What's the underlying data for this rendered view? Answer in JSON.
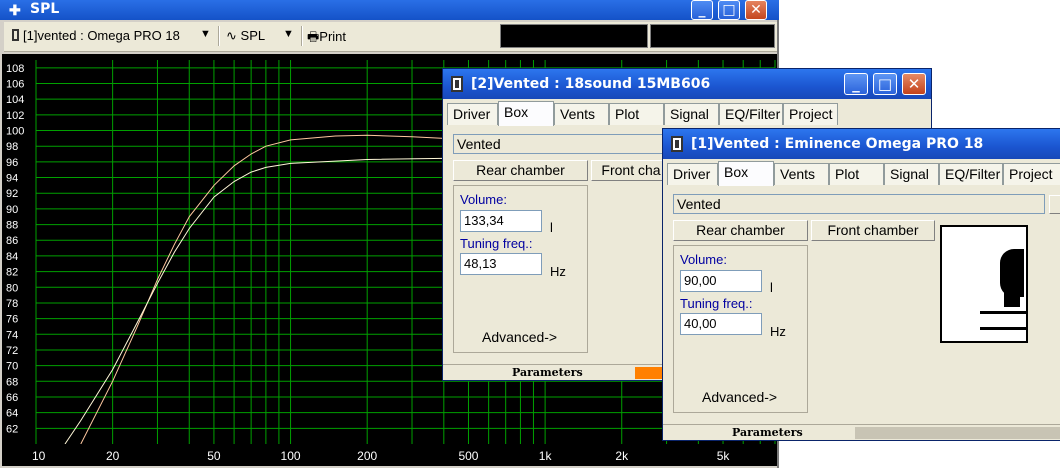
{
  "spl_window": {
    "title": "SPL",
    "toolbar": {
      "project_select": "[1]vented : Omega PRO 18",
      "view_select": "SPL",
      "print_label": "Print"
    }
  },
  "chart_data": {
    "type": "line",
    "xscale": "log",
    "xlim": [
      10,
      8000
    ],
    "ylim": [
      60,
      109
    ],
    "x_ticks": [
      10,
      20,
      50,
      100,
      200,
      500,
      1000,
      2000,
      5000
    ],
    "x_tick_labels": [
      "10",
      "20",
      "50",
      "100",
      "200",
      "500",
      "1k",
      "2k",
      "5k"
    ],
    "y_ticks": [
      62,
      64,
      66,
      68,
      70,
      72,
      74,
      76,
      78,
      80,
      82,
      84,
      86,
      88,
      90,
      92,
      94,
      96,
      98,
      100,
      102,
      104,
      106,
      108
    ],
    "grid": true,
    "colors": {
      "background": "#000000",
      "grid": "#00a000",
      "axis_text": "#ffffff"
    },
    "series": [
      {
        "color": "#ffc8a0",
        "points": [
          [
            15,
            60
          ],
          [
            20,
            68
          ],
          [
            25,
            75
          ],
          [
            30,
            81
          ],
          [
            35,
            85.5
          ],
          [
            40,
            89
          ],
          [
            50,
            93
          ],
          [
            60,
            95.5
          ],
          [
            70,
            97
          ],
          [
            80,
            98
          ],
          [
            100,
            98.8
          ],
          [
            150,
            99.3
          ],
          [
            200,
            99.4
          ],
          [
            300,
            99.2
          ],
          [
            400,
            99
          ],
          [
            500,
            98.8
          ],
          [
            800,
            98.6
          ],
          [
            8000,
            98.6
          ]
        ]
      },
      {
        "color": "#fff8d8",
        "points": [
          [
            13,
            60
          ],
          [
            15,
            63
          ],
          [
            20,
            69.5
          ],
          [
            25,
            75.5
          ],
          [
            30,
            80.5
          ],
          [
            35,
            84.5
          ],
          [
            40,
            87.5
          ],
          [
            50,
            91.5
          ],
          [
            60,
            93.5
          ],
          [
            70,
            94.7
          ],
          [
            80,
            95.3
          ],
          [
            100,
            95.8
          ],
          [
            150,
            96.1
          ],
          [
            200,
            96.3
          ],
          [
            500,
            96.5
          ],
          [
            8000,
            96.6
          ]
        ]
      }
    ]
  },
  "dialog2": {
    "title": "[2]Vented : 18sound 15MB606",
    "tabs": [
      "Driver",
      "Box",
      "Vents",
      "Plot",
      "Signal",
      "EQ/Filter",
      "Project"
    ],
    "box_type": "Vented",
    "rear_chamber_label": "Rear chamber",
    "front_chamber_label": "Front cha",
    "volume_label": "Volume:",
    "volume_value": "133,34",
    "volume_unit": "l",
    "tuning_label": "Tuning freq.:",
    "tuning_value": "48,13",
    "tuning_unit": "Hz",
    "advanced_label": "Advanced->",
    "status_label": "Parameters",
    "status_color": "#ff8000"
  },
  "dialog1": {
    "title": "[1]Vented : Eminence  Omega PRO 18",
    "tabs": [
      "Driver",
      "Box",
      "Vents",
      "Plot",
      "Signal",
      "EQ/Filter",
      "Project"
    ],
    "box_type": "Vented",
    "rear_chamber_label": "Rear chamber",
    "front_chamber_label": "Front chamber",
    "volume_label": "Volume:",
    "volume_value": "90,00",
    "volume_unit": "l",
    "tuning_label": "Tuning freq.:",
    "tuning_value": "40,00",
    "tuning_unit": "Hz",
    "advanced_label": "Advanced->",
    "status_label": "Parameters"
  }
}
